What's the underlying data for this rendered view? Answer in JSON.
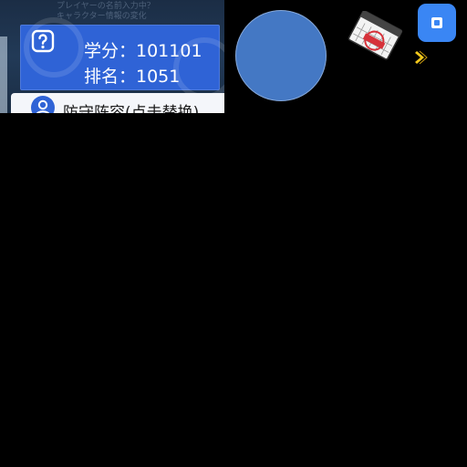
{
  "panel": {
    "bg_text_line1": "プレイヤーの名前入力中？",
    "bg_text_line2": "キャラクター情報の変化"
  },
  "score": {
    "label_line": "学分：101101",
    "rank_line": "排名：1051"
  },
  "lineup": {
    "label": "防守阵容(点击替换)"
  },
  "stamp": {
    "text": "额度有限"
  },
  "colors": {
    "card_blue": "#2f63d6",
    "circle_blue": "#4478c4",
    "button_blue": "#3a86f4",
    "arrow_yellow": "#f2c81c",
    "stamp_red": "#d6323a"
  },
  "icons": {
    "help": "question-mark-icon",
    "user": "user-icon",
    "arrow": "chevron-right-icon",
    "square": "stop-icon"
  }
}
